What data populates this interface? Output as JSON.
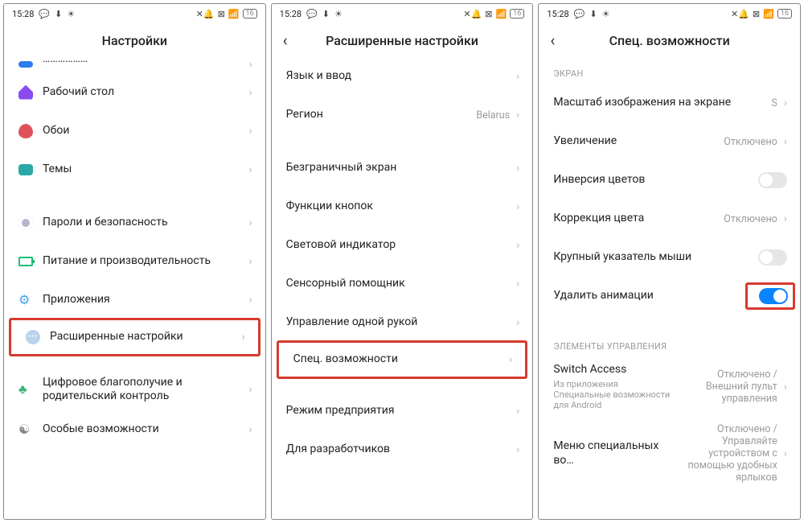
{
  "status": {
    "time": "15:28",
    "battery": "16"
  },
  "s1": {
    "title": "Настройки",
    "cutoff": "Уведомления",
    "desktop": "Рабочий стол",
    "wallpaper": "Обои",
    "themes": "Темы",
    "passwords": "Пароли и безопасность",
    "power": "Питание и производительность",
    "apps": "Приложения",
    "advanced": "Расширенные настройки",
    "wellbeing": "Цифровое благополучие и родительский контроль",
    "special": "Особые возможности"
  },
  "s2": {
    "title": "Расширенные настройки",
    "lang": "Язык и ввод",
    "region": "Регион",
    "region_val": "Belarus",
    "fullscreen": "Безграничный экран",
    "buttons": "Функции кнопок",
    "led": "Световой индикатор",
    "touchassist": "Сенсорный помощник",
    "onehand": "Управление одной рукой",
    "accessibility": "Спец. возможности",
    "enterprise": "Режим предприятия",
    "developer": "Для разработчиков"
  },
  "s3": {
    "title": "Спец. возможности",
    "sec_screen": "ЭКРАН",
    "scale": "Масштаб изображения на экране",
    "scale_val": "S",
    "zoom": "Увеличение",
    "zoom_val": "Отключено",
    "invert": "Инверсия цветов",
    "colorcorr": "Коррекция цвета",
    "colorcorr_val": "Отключено",
    "bigcursor": "Крупный указатель мыши",
    "removeanim": "Удалить анимации",
    "sec_controls": "ЭЛЕМЕНТЫ УПРАВЛЕНИЯ",
    "switch": "Switch Access",
    "switch_sub": "Из приложения Специальные возможности для Android",
    "switch_val": "Отключено / Внешний пульт управления",
    "menu": "Меню специальных во…",
    "menu_val": "Отключено / Управляйте устройством с помощью удобных ярлыков"
  }
}
